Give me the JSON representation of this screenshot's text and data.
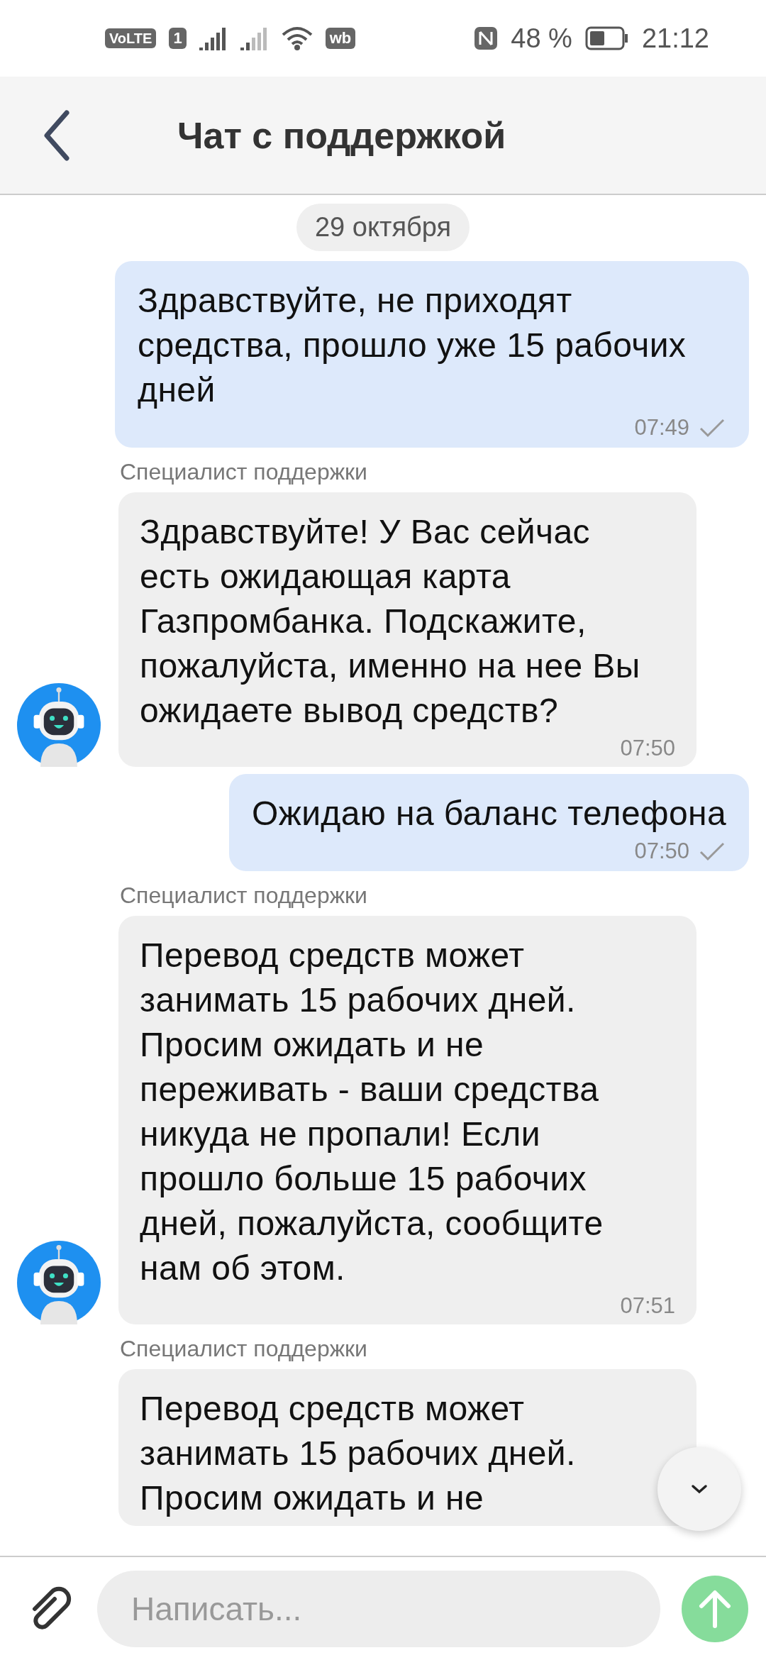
{
  "status_bar": {
    "volte": "VoLTE",
    "sim": "1",
    "app_badge": "wb",
    "battery": "48 %",
    "time": "21:12"
  },
  "header": {
    "title": "Чат с поддержкой"
  },
  "date_chip": "29 октября",
  "messages": [
    {
      "kind": "outgoing",
      "text": "Здравствуйте, не приходят средства, прошло уже 15 рабочих дней",
      "time": "07:49",
      "delivered": true
    },
    {
      "kind": "incoming",
      "sender": "Специалист поддержки",
      "text": "Здравствуйте! У Вас сейчас есть ожидающая карта Газпромбанка. Подскажите, пожалуйста, именно на нее Вы ожидаете вывод средств?",
      "time": "07:50"
    },
    {
      "kind": "outgoing",
      "text": "Ожидаю на баланс телефона",
      "time": "07:50",
      "delivered": true
    },
    {
      "kind": "incoming",
      "sender": "Специалист поддержки",
      "text": "Перевод средств может занимать 15 рабочих дней. Просим ожидать и не переживать - ваши средства никуда не пропали! Если прошло больше 15 рабочих дней, пожалуйста, сообщите нам об этом.",
      "time": "07:51"
    },
    {
      "kind": "incoming",
      "sender": "Специалист поддержки",
      "text": "Перевод средств может занимать 15 рабочих дней. Просим ожидать и не"
    }
  ],
  "composer": {
    "placeholder": "Написать..."
  }
}
